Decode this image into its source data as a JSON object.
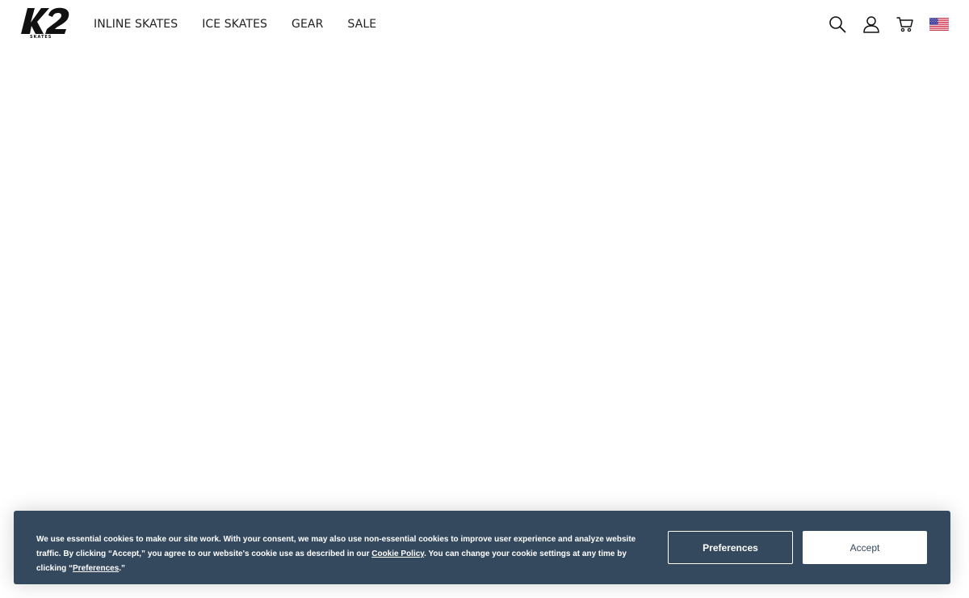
{
  "brand": {
    "logo_text": "K2",
    "logo_sub": "SKATES"
  },
  "nav": {
    "items": [
      {
        "label": "INLINE SKATES"
      },
      {
        "label": "ICE SKATES"
      },
      {
        "label": "GEAR"
      },
      {
        "label": "SALE"
      }
    ]
  },
  "utilities": {
    "icons": [
      "search-icon",
      "account-icon",
      "cart-icon",
      "us-flag-icon"
    ]
  },
  "cookie_banner": {
    "text_before_policy": "We use essential cookies to make our site work. With your consent, we may also use non-essential cookies to improve user experience and analyze website traffic. By clicking “Accept,” you agree to our website's cookie use as described in our ",
    "policy_link": "Cookie Policy",
    "text_between": ". You can change your cookie settings at any time by clicking “",
    "preferences_link": "Preferences",
    "text_after": ".”",
    "preferences_button": "Preferences",
    "accept_button": "Accept",
    "background_color": "#34495e"
  }
}
